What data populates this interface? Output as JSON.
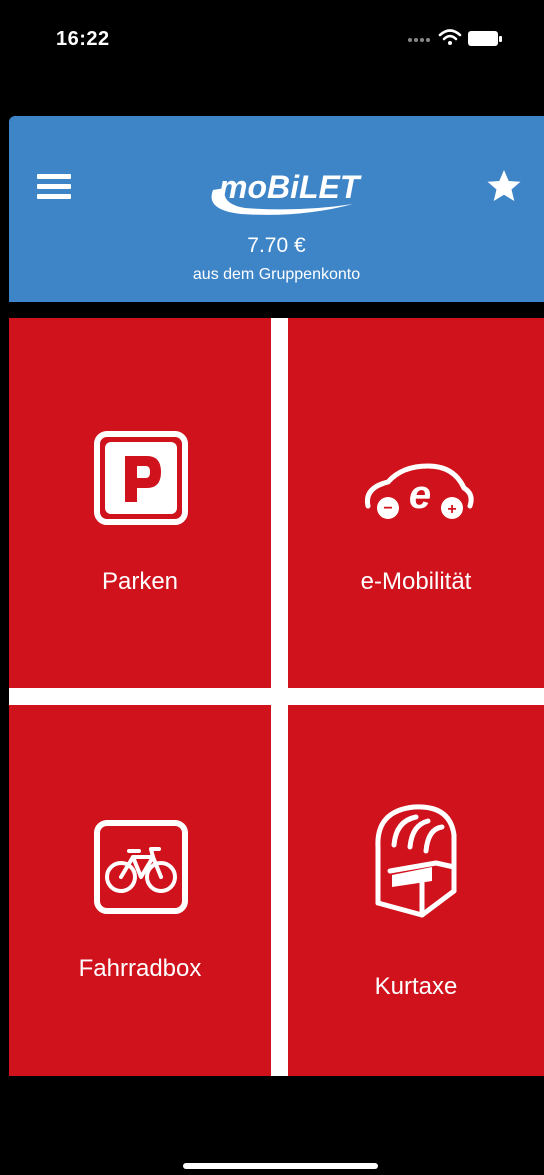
{
  "status": {
    "time": "16:22"
  },
  "header": {
    "logo_text": "moBiLET",
    "balance": "7.70 €",
    "balance_caption": "aus dem Gruppenkonto",
    "colors": {
      "background": "#3e85c8"
    }
  },
  "tiles": [
    {
      "label": "Parken",
      "icon": "parking-icon"
    },
    {
      "label": "e-Mobilität",
      "icon": "electric-car-icon"
    },
    {
      "label": "Fahrradbox",
      "icon": "bicycle-icon"
    },
    {
      "label": "Kurtaxe",
      "icon": "beach-chair-icon"
    }
  ],
  "colors": {
    "tile": "#d0121c",
    "header": "#3e85c8",
    "background": "#000000"
  }
}
